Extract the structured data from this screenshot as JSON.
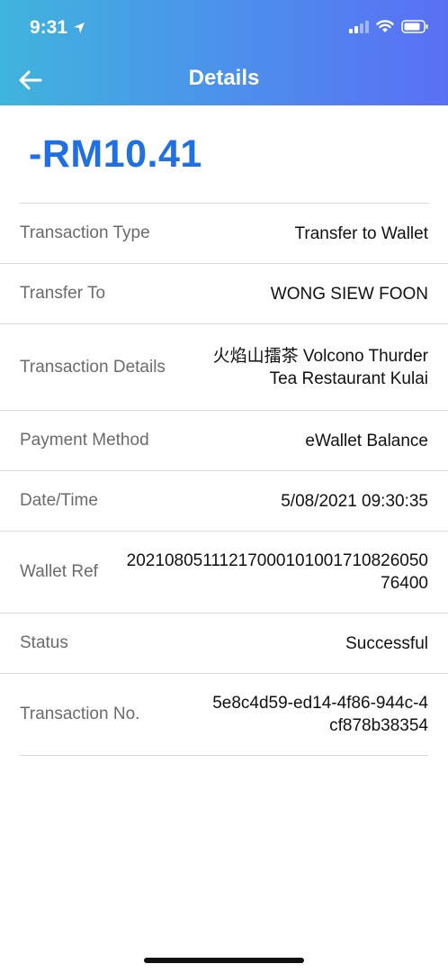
{
  "status_bar": {
    "time": "9:31"
  },
  "nav": {
    "title": "Details"
  },
  "amount": "-RM10.41",
  "details": [
    {
      "label": "Transaction Type",
      "value": "Transfer to Wallet"
    },
    {
      "label": "Transfer To",
      "value": "WONG SIEW FOON"
    },
    {
      "label": "Transaction Details",
      "value": "火焰山擂茶 Volcono Thurder Tea Restaurant Kulai"
    },
    {
      "label": "Payment Method",
      "value": "eWallet Balance"
    },
    {
      "label": "Date/Time",
      "value": "5/08/2021 09:30:35"
    },
    {
      "label": "Wallet Ref",
      "value": "20210805111217000101001710826050 76400"
    },
    {
      "label": "Status",
      "value": "Successful"
    },
    {
      "label": "Transaction No.",
      "value": "5e8c4d59-ed14-4f86-944c-4cf878b38354"
    }
  ],
  "colors": {
    "amount": "#1f6fe5",
    "header_gradient_start": "#3fb4dc",
    "header_gradient_end": "#5a6ff5"
  }
}
